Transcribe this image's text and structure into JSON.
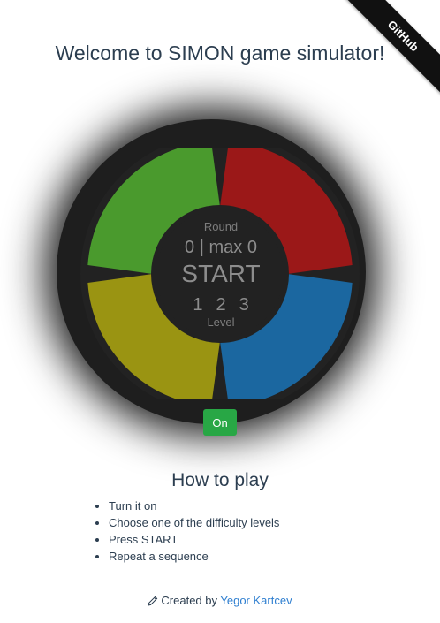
{
  "github_ribbon": {
    "label": "GitHub"
  },
  "title": "Welcome to SIMON game simulator!",
  "game": {
    "round_label": "Round",
    "round_value": "0 | max 0",
    "start_label": "START",
    "levels": [
      "1",
      "2",
      "3"
    ],
    "level_label": "Level",
    "colors": {
      "green": "#4a9a2d",
      "red": "#9b1818",
      "yellow": "#9a9412",
      "blue": "#1b67a0",
      "body": "#222222"
    }
  },
  "power_button": {
    "label": "On",
    "color": "#28a745"
  },
  "how_to_play": {
    "title": "How to play",
    "steps": [
      "Turn it on",
      "Choose one of the difficulty levels",
      "Press START",
      "Repeat a sequence"
    ]
  },
  "footer": {
    "icon": "pencil-icon",
    "prefix": "Created by",
    "author": "Yegor Kartcev"
  }
}
